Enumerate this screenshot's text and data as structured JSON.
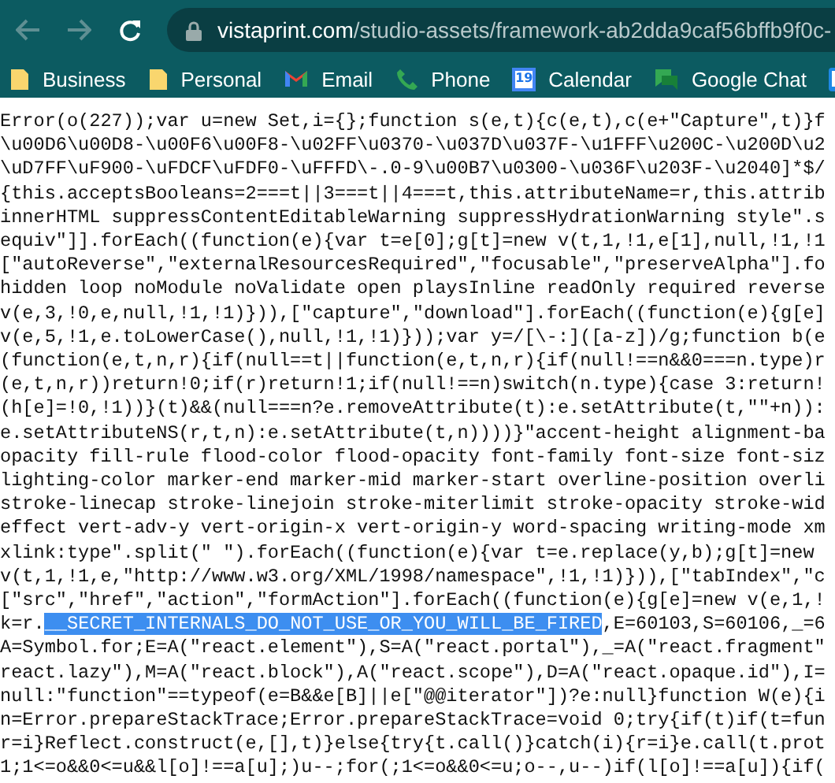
{
  "toolbar": {
    "back": {
      "disabled": true
    },
    "forward": {
      "disabled": true
    },
    "address": {
      "host": "vistaprint.com",
      "path": "/studio-assets/framework-ab2dda9caf56bffb9f0c-"
    }
  },
  "bookmarks": [
    {
      "kind": "folder",
      "label": "Business"
    },
    {
      "kind": "folder",
      "label": "Personal"
    },
    {
      "kind": "mail",
      "label": "Email"
    },
    {
      "kind": "phone",
      "label": "Phone"
    },
    {
      "kind": "calendar",
      "label": "Calendar",
      "icon_text": "19"
    },
    {
      "kind": "chat",
      "label": "Google Chat"
    },
    {
      "kind": "board"
    }
  ],
  "source_lines": [
    {
      "text": "Error(o(227));var u=new Set,i={};function s(e,t){c(e,t),c(e+\"Capture\",t)}f"
    },
    {
      "text": "\\u00D6\\u00D8-\\u00F6\\u00F8-\\u02FF\\u0370-\\u037D\\u037F-\\u1FFF\\u200C-\\u200D\\u2"
    },
    {
      "text": "\\uD7FF\\uF900-\\uFDCF\\uFDF0-\\uFFFD\\-.0-9\\u00B7\\u0300-\\u036F\\u203F-\\u2040]*$/"
    },
    {
      "text": "{this.acceptsBooleans=2===t||3===t||4===t,this.attributeName=r,this.attrib"
    },
    {
      "text": "innerHTML suppressContentEditableWarning suppressHydrationWarning style\".s"
    },
    {
      "text": "equiv\"]].forEach((function(e){var t=e[0];g[t]=new v(t,1,!1,e[1],null,!1,!1"
    },
    {
      "text": "[\"autoReverse\",\"externalResourcesRequired\",\"focusable\",\"preserveAlpha\"].fo"
    },
    {
      "text": "hidden loop noModule noValidate open playsInline readOnly required reverse"
    },
    {
      "text": "v(e,3,!0,e,null,!1,!1)})),[\"capture\",\"download\"].forEach((function(e){g[e]"
    },
    {
      "text": "v(e,5,!1,e.toLowerCase(),null,!1,!1)}));var y=/[\\-:]([a-z])/g;function b(e"
    },
    {
      "text": "(function(e,t,n,r){if(null==t||function(e,t,n,r){if(null!==n&&0===n.type)r"
    },
    {
      "text": "(e,t,n,r))return!0;if(r)return!1;if(null!==n)switch(n.type){case 3:return!"
    },
    {
      "text": "(h[e]=!0,!1))}(t)&&(null===n?e.removeAttribute(t):e.setAttribute(t,\"\"+n)):"
    },
    {
      "text": "e.setAttributeNS(r,t,n):e.setAttribute(t,n))))}\"accent-height alignment-ba"
    },
    {
      "text": "opacity fill-rule flood-color flood-opacity font-family font-size font-siz"
    },
    {
      "text": "lighting-color marker-end marker-mid marker-start overline-position overli"
    },
    {
      "text": "stroke-linecap stroke-linejoin stroke-miterlimit stroke-opacity stroke-wid"
    },
    {
      "text": "effect vert-adv-y vert-origin-x vert-origin-y word-spacing writing-mode xm"
    },
    {
      "text": "xlink:type\".split(\" \").forEach((function(e){var t=e.replace(y,b);g[t]=new"
    },
    {
      "text": "v(t,1,!1,e,\"http://www.w3.org/XML/1998/namespace\",!1,!1)})),[\"tabIndex\",\"c"
    },
    {
      "text": "[\"src\",\"href\",\"action\",\"formAction\"].forEach((function(e){g[e]=new v(e,1,!"
    },
    {
      "parts": [
        {
          "text": "k=r.",
          "selected": false
        },
        {
          "text": "__SECRET_INTERNALS_DO_NOT_USE_OR_YOU_WILL_BE_FIRED",
          "selected": true
        },
        {
          "text": ",E=60103,S=60106,_=6",
          "selected": false
        }
      ]
    },
    {
      "text": "A=Symbol.for;E=A(\"react.element\"),S=A(\"react.portal\"),_=A(\"react.fragment\""
    },
    {
      "text": "react.lazy\"),M=A(\"react.block\"),A(\"react.scope\"),D=A(\"react.opaque.id\"),I="
    },
    {
      "text": "null:\"function\"==typeof(e=B&&e[B]||e[\"@@iterator\"])?e:null}function W(e){i"
    },
    {
      "text": "n=Error.prepareStackTrace;Error.prepareStackTrace=void 0;try{if(t)if(t=fun"
    },
    {
      "text": "r=i}Reflect.construct(e,[],t)}else{try{t.call()}catch(i){r=i}e.call(t.prot"
    },
    {
      "text": "1;1<=o&&0<=u&&l[o]!==a[u];)u--;for(;1<=o&&0<=u;o--,u--)if(l[o]!==a[u]){if("
    }
  ]
}
